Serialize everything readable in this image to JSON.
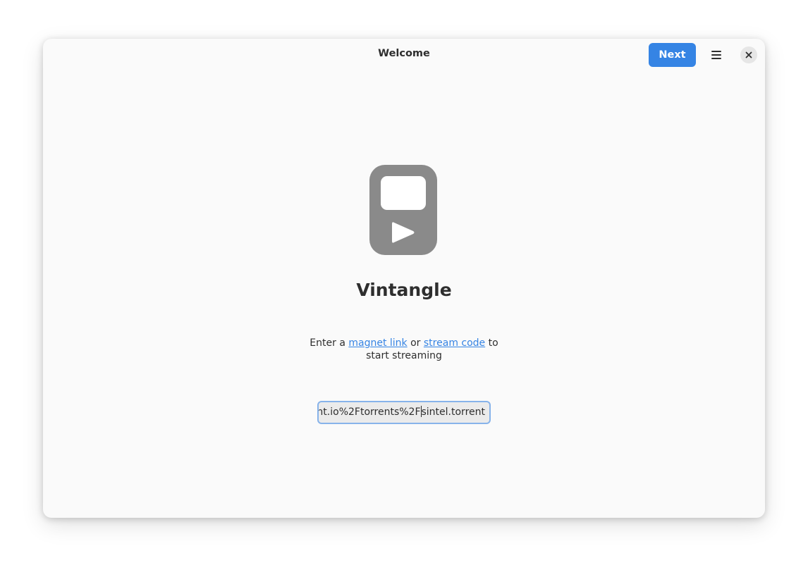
{
  "window": {
    "title": "Welcome"
  },
  "header": {
    "next_label": "Next",
    "menu_icon": "hamburger-menu-icon",
    "close_icon": "close-icon"
  },
  "app": {
    "icon": "video-player-icon",
    "name": "Vintangle"
  },
  "description": {
    "prefix": "Enter a ",
    "link_magnet": "magnet link",
    "middle": " or ",
    "link_stream": "stream code",
    "suffix": " to start streaming"
  },
  "input": {
    "value_before_caret": "nt.io%2Ftorrents%2F",
    "value_after_caret": "sintel.torrent"
  },
  "colors": {
    "accent": "#3584e4",
    "icon_gray": "#8a8a8a",
    "window_bg": "#fafafa"
  }
}
